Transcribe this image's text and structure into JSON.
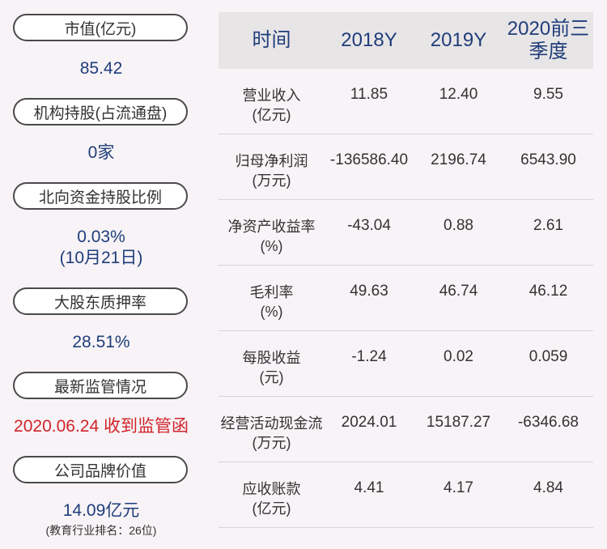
{
  "left": {
    "items": [
      {
        "label": "市值(亿元)",
        "value": "85.42"
      },
      {
        "label": "机构持股(占流通盘)",
        "value": "0家"
      },
      {
        "label": "北向资金持股比例",
        "value": "0.03%",
        "value2": "(10月21日)"
      },
      {
        "label": "大股东质押率",
        "value": "28.51%"
      },
      {
        "label": "最新监管情况",
        "value": "2020.06.24 收到监管函"
      },
      {
        "label": "公司品牌价值",
        "value": "14.09亿元",
        "note": "(教育行业排名：26位)"
      }
    ]
  },
  "table": {
    "headers": [
      "时间",
      "2018Y",
      "2019Y",
      "2020前三季度"
    ],
    "rows": [
      {
        "label": "营业收入\n(亿元)",
        "v": [
          "11.85",
          "12.40",
          "9.55"
        ]
      },
      {
        "label": "归母净利润\n(万元)",
        "v": [
          "-136586.40",
          "2196.74",
          "6543.90"
        ]
      },
      {
        "label": "净资产收益率\n(%)",
        "v": [
          "-43.04",
          "0.88",
          "2.61"
        ]
      },
      {
        "label": "毛利率\n(%)",
        "v": [
          "49.63",
          "46.74",
          "46.12"
        ]
      },
      {
        "label": "每股收益\n(元)",
        "v": [
          "-1.24",
          "0.02",
          "0.059"
        ]
      },
      {
        "label": "经营活动现金流\n(万元)",
        "v": [
          "2024.01",
          "15187.27",
          "-6346.68"
        ]
      },
      {
        "label": "应收账款\n(亿元)",
        "v": [
          "4.41",
          "4.17",
          "4.84"
        ]
      }
    ]
  },
  "colors": {
    "accent": "#1f3d7a",
    "alert": "#d0242a",
    "header_bg": "#e8e5e7",
    "page_bg": "#f7f3f6"
  }
}
